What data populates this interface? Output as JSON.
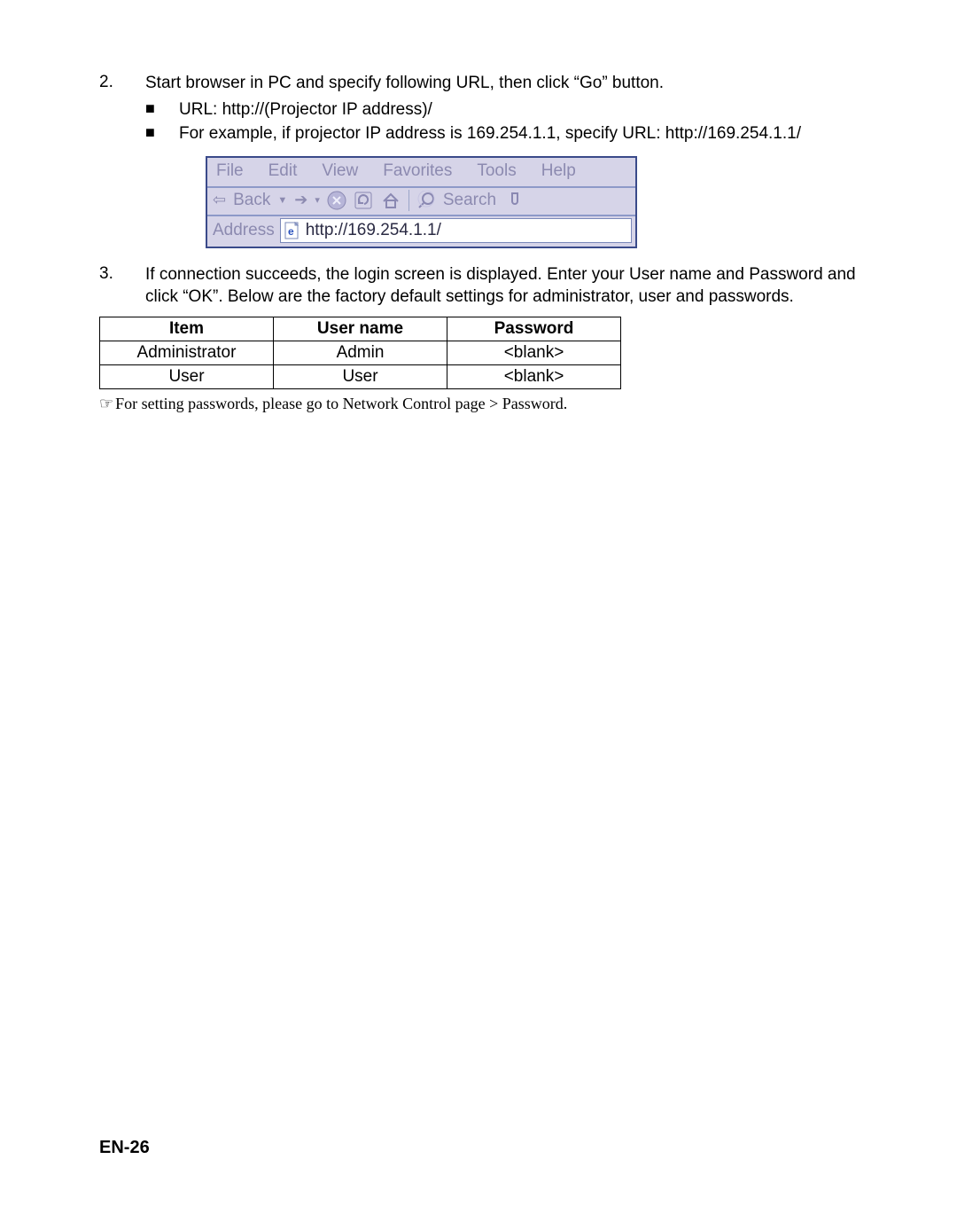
{
  "steps": {
    "s2": {
      "num": "2.",
      "text": "Start browser in PC and specify following URL, then click “Go” button.",
      "sub1": "URL: http://(Projector IP address)/",
      "sub2": "For example, if projector IP address is 169.254.1.1, specify URL: http://169.254.1.1/"
    },
    "s3": {
      "num": "3.",
      "text": "If connection succeeds, the login screen is displayed. Enter your User name and Password and click “OK”. Below are the factory default settings for administrator, user and passwords."
    }
  },
  "browser": {
    "menu": {
      "file": "File",
      "edit": "Edit",
      "view": "View",
      "favorites": "Favorites",
      "tools": "Tools",
      "help": "Help"
    },
    "toolbar": {
      "back": "Back",
      "search": "Search"
    },
    "addressLabel": "Address",
    "url": "http://169.254.1.1/"
  },
  "table": {
    "headers": {
      "item": "Item",
      "user": "User name",
      "pass": "Password"
    },
    "rows": [
      {
        "item": "Administrator",
        "user": "Admin",
        "pass": "<blank>"
      },
      {
        "item": "User",
        "user": "User",
        "pass": "<blank>"
      }
    ]
  },
  "footnote": "For setting passwords, please go to Network Control page > Password.",
  "pageNumber": "EN-26",
  "glyphs": {
    "bullet": "■",
    "hand": "☞"
  }
}
